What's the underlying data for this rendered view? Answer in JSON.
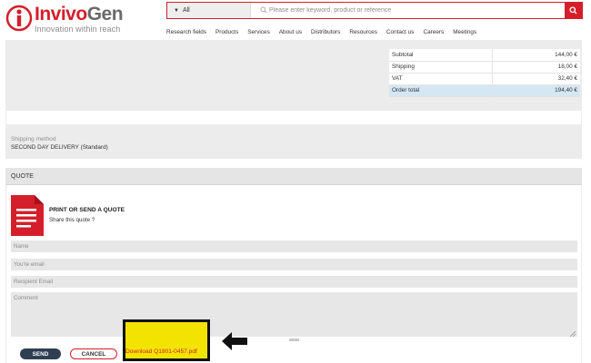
{
  "brand": {
    "name_part1": "Invivo",
    "name_part2": "Gen",
    "tagline": "Innovation within reach",
    "color": "#d41f2b"
  },
  "search": {
    "category": "All",
    "placeholder": "Please enter keyword, product or reference",
    "icon": "search-icon"
  },
  "nav": {
    "items": [
      "Research fields",
      "Products",
      "Services",
      "About us",
      "Distributors",
      "Resources",
      "Contact us",
      "Careers",
      "Meetings"
    ]
  },
  "totals": {
    "rows": [
      {
        "label": "Subtotal",
        "value": "144,00 €"
      },
      {
        "label": "Shipping",
        "value": "18,00 €"
      },
      {
        "label": "VAT",
        "value": "32,40 €"
      },
      {
        "label": "Order total",
        "value": "194,40 €"
      }
    ],
    "highlight_color": "#d4e7f3"
  },
  "shipping": {
    "title": "Shipping method",
    "value": "SECOND DAY DELIVERY (Standard)"
  },
  "quote": {
    "heading": "QUOTE",
    "print_title": "PRINT OR SEND A QUOTE",
    "print_subtitle": "Share this quote ?",
    "icon": "pdf-document-icon",
    "fields": {
      "name_placeholder": "Name",
      "email_placeholder": "You're email",
      "recipient_placeholder": "Recipient Email",
      "comment_placeholder": "Comment"
    },
    "send_label": "SEND",
    "cancel_label": "CANCEL",
    "download_label": "Download Q1801-0457.pdf",
    "highlight_color": "#f3e400"
  }
}
